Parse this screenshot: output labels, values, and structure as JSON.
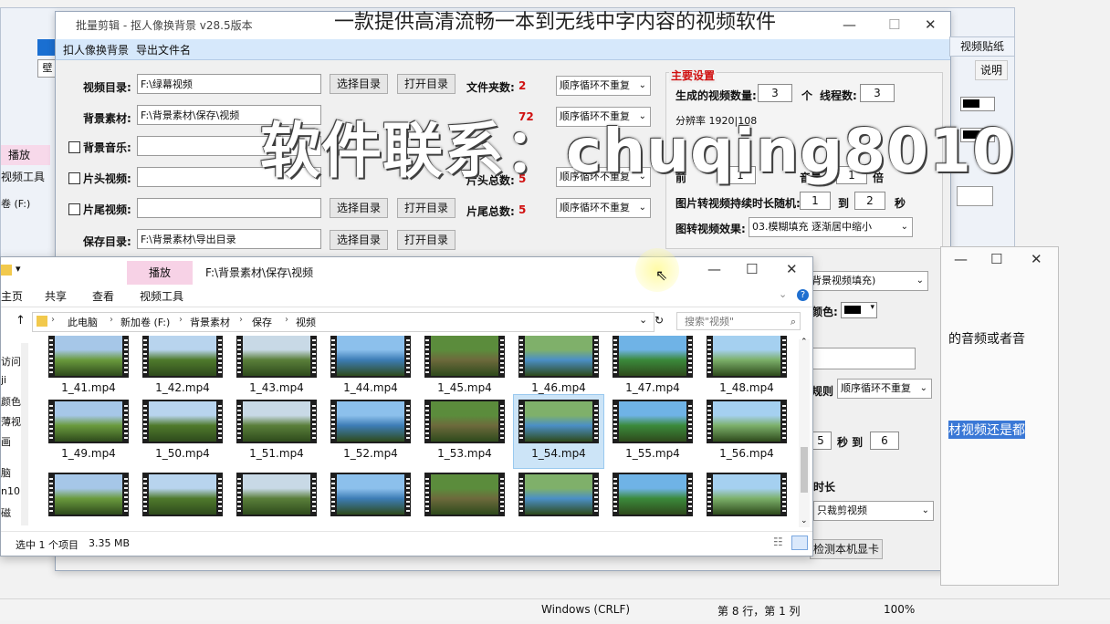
{
  "video_title": "一款提供高清流畅一本到无线中字内容的视频软件",
  "watermark": "软件联系：chuqing8010",
  "notepad": {
    "encoding": "Windows (CRLF)",
    "position": "第 8 行，第 1 列",
    "zoom": "100%"
  },
  "back_left": {
    "play_tab": "播放",
    "video_tools": "视频工具",
    "drive_frag": "卷 (F:)",
    "side_frag": "壁"
  },
  "app": {
    "title": "批量剪辑 - 抠人像换背景 v28.5版本",
    "menu": [
      "扣人像换背景",
      "导出文件名"
    ],
    "outside_tab": "视频贴纸",
    "outside_help": "说明",
    "rows": [
      {
        "label": "视频目录:",
        "value": "F:\\绿幕视频",
        "checkbox": false,
        "stat_label": "文件夹数:",
        "stat_value": "2",
        "mode": "顺序循环不重复"
      },
      {
        "label": "背景素材:",
        "value": "F:\\背景素材\\保存\\视频",
        "checkbox": false,
        "stat_label": "",
        "stat_value": "72",
        "mode": "顺序循环不重复"
      },
      {
        "label": "背景音乐:",
        "value": "",
        "checkbox": true,
        "stat_label": "",
        "stat_value": "",
        "mode": ""
      },
      {
        "label": "片头视频:",
        "value": "",
        "checkbox": true,
        "stat_label": "片头总数:",
        "stat_value": "5",
        "mode": "顺序循环不重复"
      },
      {
        "label": "片尾视频:",
        "value": "",
        "checkbox": true,
        "stat_label": "片尾总数:",
        "stat_value": "5",
        "mode": "顺序循环不重复"
      },
      {
        "label": "保存目录:",
        "value": "F:\\背景素材\\导出目录",
        "checkbox": false,
        "stat_label": "",
        "stat_value": "",
        "mode": ""
      }
    ],
    "btn_select": "选择目录",
    "btn_open": "打开目录",
    "main_settings": {
      "title": "主要设置",
      "gen_count_label": "生成的视频数量:",
      "gen_count": "3",
      "unit": "个",
      "threads_label": "线程数:",
      "threads": "3",
      "resolution_frag": "分辨率 1920|108",
      "front_frag": "前",
      "front_value": "1",
      "volume_frag": "音量:",
      "volume_value": "1",
      "times": "倍",
      "random_label": "图片转视频持续时长随机:",
      "random_from": "1",
      "to": "到",
      "random_to": "2",
      "sec": "秒",
      "effect_label": "图转视频效果:",
      "effect_value": "03.模糊填充 逐渐居中缩小"
    },
    "lower": {
      "bg_fill": "背景视频填充)",
      "color_label": "颜色:",
      "rule_label": "规则",
      "rule_value": "顺序循环不重复",
      "sec_from": "5",
      "sec_to_label": "秒 到",
      "sec_to": "6",
      "duration_label": "时长",
      "crop_value": "只裁剪视频",
      "detect_btn": "检测本机显卡"
    }
  },
  "right_dialog": {
    "text1": "的音频或者音",
    "highlight": "材视频还是都"
  },
  "explorer": {
    "tabs": [
      "主页",
      "共享",
      "查看"
    ],
    "context_tab": "播放",
    "context_sub": "视频工具",
    "path_title": "F:\\背景素材\\保存\\视频",
    "breadcrumb": [
      "此电脑",
      "新加卷 (F:)",
      "背景素材",
      "保存",
      "视频"
    ],
    "search_placeholder": "搜索\"视频\"",
    "left_nav": [
      "访问",
      "ji",
      "颜色",
      "薄视",
      "画",
      "脑",
      "n10",
      "磁"
    ],
    "status_selected": "选中 1 个项目",
    "status_size": "3.35 MB",
    "files_row1": [
      "1_41.mp4",
      "1_42.mp4",
      "1_43.mp4",
      "1_44.mp4",
      "1_45.mp4",
      "1_46.mp4",
      "1_47.mp4",
      "1_48.mp4"
    ],
    "files_row2": [
      "1_49.mp4",
      "1_50.mp4",
      "1_51.mp4",
      "1_52.mp4",
      "1_53.mp4",
      "1_54.mp4",
      "1_55.mp4",
      "1_56.mp4"
    ],
    "selected_file": "1_54.mp4"
  }
}
